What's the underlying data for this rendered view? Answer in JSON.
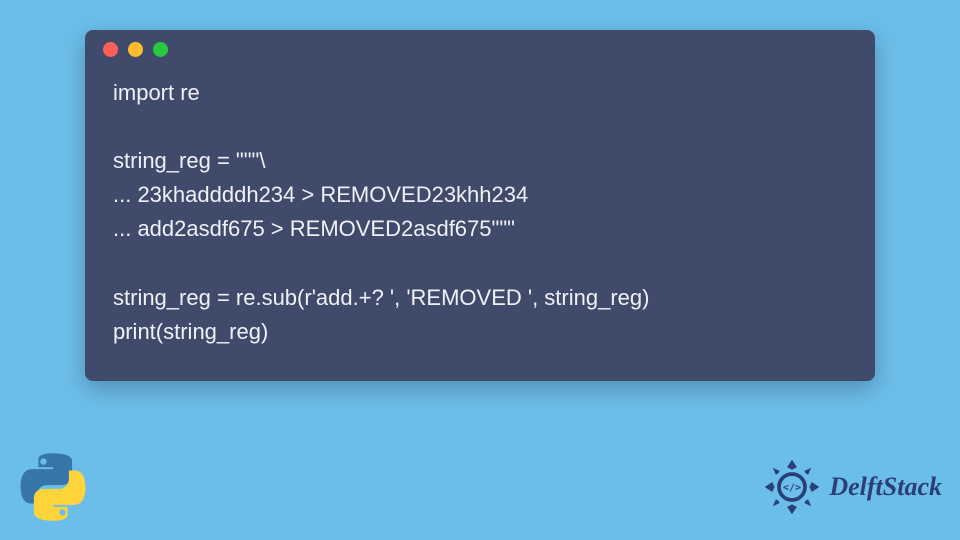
{
  "code": {
    "line1": "import re",
    "line2": "",
    "line3": "string_reg = \"\"\"\\",
    "line4": "... 23khaddddh234 > REMOVED23khh234",
    "line5": "... add2asdf675 > REMOVED2asdf675\"\"\"",
    "line6": "",
    "line7": "string_reg = re.sub(r'add.+? ', 'REMOVED ', string_reg)",
    "line8": "print(string_reg)"
  },
  "brand": {
    "name": "DelftStack"
  }
}
